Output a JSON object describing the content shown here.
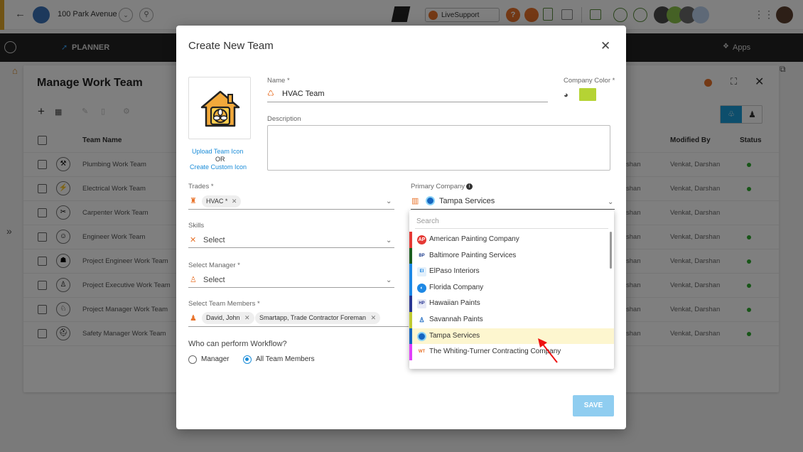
{
  "header": {
    "project_name": "100 Park Avenue",
    "livesupport_label": "LiveSupport"
  },
  "nav": {
    "planner_label": "PLANNER",
    "apps_label": "Apps"
  },
  "background": {
    "page_title": "Manage Work Team",
    "columns": {
      "team_name": "Team Name",
      "modified_by": "Modified By",
      "status": "Status"
    },
    "rows": [
      {
        "name": "Plumbing Work Team",
        "owner_suffix": "shan",
        "modified_by": "Venkat, Darshan",
        "active": true
      },
      {
        "name": "Electrical Work Team",
        "owner_suffix": "shan",
        "modified_by": "Venkat, Darshan",
        "active": true
      },
      {
        "name": "Carpenter Work Team",
        "owner_suffix": "shan",
        "modified_by": "Venkat, Darshan",
        "active": false
      },
      {
        "name": "Engineer Work Team",
        "owner_suffix": "shan",
        "modified_by": "Venkat, Darshan",
        "active": true
      },
      {
        "name": "Project Engineer Work Team",
        "owner_suffix": "shan",
        "modified_by": "Venkat, Darshan",
        "active": true
      },
      {
        "name": "Project Executive Work Team",
        "owner_suffix": "shan",
        "modified_by": "Venkat, Darshan",
        "active": true
      },
      {
        "name": "Project Manager Work Team",
        "owner_suffix": "shan",
        "modified_by": "Venkat, Darshan",
        "active": true
      },
      {
        "name": "Safety Manager Work Team",
        "owner_suffix": "shan",
        "modified_by": "Venkat, Darshan",
        "active": true
      }
    ],
    "status_color": "#2eab2e"
  },
  "modal": {
    "title": "Create New Team",
    "upload_link": "Upload Team Icon",
    "or_text": "OR",
    "custom_link": "Create Custom Icon",
    "name_label": "Name *",
    "name_value": "HVAC Team",
    "company_color_label": "Company Color *",
    "company_color": "#b5d334",
    "description_label": "Description",
    "trades_label": "Trades *",
    "trade_chip": "HVAC *",
    "skills_label": "Skills",
    "skills_placeholder": "Select",
    "manager_label": "Select Manager *",
    "manager_placeholder": "Select",
    "members_label": "Select Team Members *",
    "members": [
      "David, John",
      "Smartapp, Trade Contractor Foreman"
    ],
    "primary_company_label": "Primary Company",
    "primary_company_value": "Tampa Services",
    "workflow_question": "Who can perform Workflow?",
    "workflow_options": [
      {
        "label": "Manager",
        "selected": false
      },
      {
        "label": "All Team Members",
        "selected": true
      }
    ],
    "save_label": "SAVE"
  },
  "company_dropdown": {
    "search_placeholder": "Search",
    "items": [
      {
        "label": "American Painting Company",
        "color": "#e53935"
      },
      {
        "label": "Baltimore Painting Services",
        "color": "#1b5e20"
      },
      {
        "label": "ElPaso Interiors",
        "color": "#1e88e5"
      },
      {
        "label": "Florida Company",
        "color": "#1e88e5"
      },
      {
        "label": "Hawaiian Paints",
        "color": "#283593"
      },
      {
        "label": "Savannah Paints",
        "color": "#c0ca33"
      },
      {
        "label": "Tampa Services",
        "color": "#1565c0",
        "highlighted": true
      },
      {
        "label": "The Whiting-Turner Contracting Company",
        "color": "#e040fb"
      }
    ]
  }
}
